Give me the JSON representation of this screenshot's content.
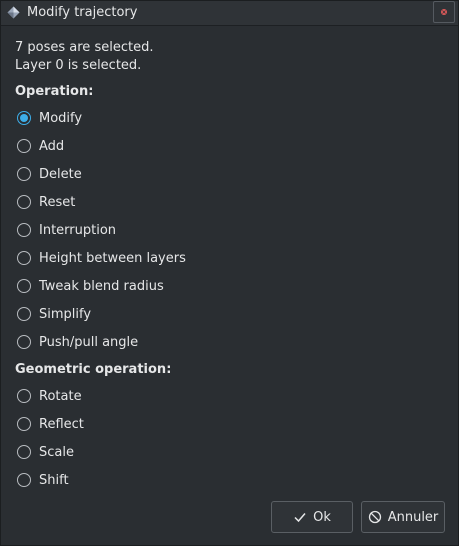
{
  "window": {
    "title": "Modify trajectory",
    "icon": "diamond-icon",
    "close_icon": "close-icon"
  },
  "info": {
    "poses": "7 poses are selected.",
    "layer": "Layer 0 is selected."
  },
  "operation": {
    "heading": "Operation:",
    "selected": "Modify",
    "options": [
      "Modify",
      "Add",
      "Delete",
      "Reset",
      "Interruption",
      "Height between layers",
      "Tweak blend radius",
      "Simplify",
      "Push/pull angle"
    ]
  },
  "geometric": {
    "heading": "Geometric operation:",
    "selected": null,
    "options": [
      "Rotate",
      "Reflect",
      "Scale",
      "Shift"
    ]
  },
  "buttons": {
    "ok_label": "Ok",
    "ok_icon": "check-icon",
    "cancel_label": "Annuler",
    "cancel_icon": "cancel-icon"
  },
  "colors": {
    "accent": "#3daee9",
    "background": "#2a2e32",
    "close_dot": "#e05a5a"
  }
}
